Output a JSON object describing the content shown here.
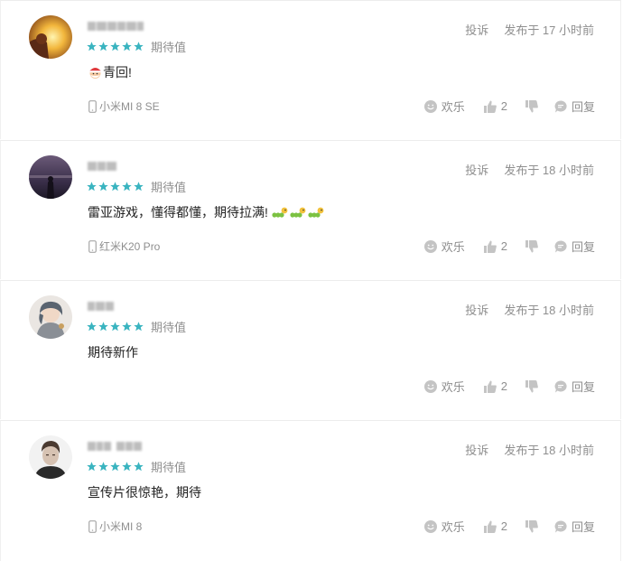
{
  "reviews": [
    {
      "rating_label": "期待值",
      "stars": 5,
      "report": "投诉",
      "posted": "发布于 17 小时前",
      "text": "青回!",
      "device": "小米MI 8 SE",
      "fun_label": "欢乐",
      "like_count": "2",
      "reply_label": "回复"
    },
    {
      "rating_label": "期待值",
      "stars": 5,
      "report": "投诉",
      "posted": "发布于 18 小时前",
      "text": "雷亚游戏，懂得都懂，期待拉满!",
      "device": "红米K20 Pro",
      "fun_label": "欢乐",
      "like_count": "2",
      "reply_label": "回复"
    },
    {
      "rating_label": "期待值",
      "stars": 5,
      "report": "投诉",
      "posted": "发布于 18 小时前",
      "text": "期待新作",
      "device": "",
      "fun_label": "欢乐",
      "like_count": "2",
      "reply_label": "回复"
    },
    {
      "rating_label": "期待值",
      "stars": 5,
      "report": "投诉",
      "posted": "发布于 18 小时前",
      "text": "宣传片很惊艳，期待",
      "device": "小米MI 8",
      "fun_label": "欢乐",
      "like_count": "2",
      "reply_label": "回复"
    }
  ],
  "colors": {
    "star": "#3ab4c0",
    "muted": "#8f8f8f",
    "text": "#222222",
    "icon": "#c4c4c4"
  }
}
